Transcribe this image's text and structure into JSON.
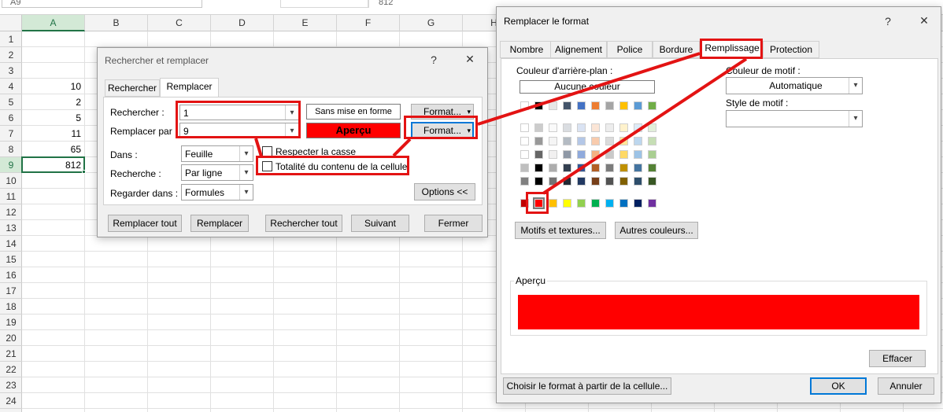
{
  "sheet": {
    "name_box": "A9",
    "formula_value": "812",
    "columns": [
      "A",
      "B",
      "C",
      "D",
      "E",
      "F",
      "G",
      "H"
    ],
    "rows": [
      "1",
      "2",
      "3",
      "4",
      "5",
      "6",
      "7",
      "8",
      "9",
      "10",
      "11",
      "12",
      "13",
      "14",
      "15",
      "16",
      "17",
      "18",
      "19",
      "20",
      "21",
      "22",
      "23",
      "24"
    ],
    "cells": [
      {
        "row": 4,
        "value": "10"
      },
      {
        "row": 5,
        "value": "2"
      },
      {
        "row": 6,
        "value": "5"
      },
      {
        "row": 7,
        "value": "11"
      },
      {
        "row": 8,
        "value": "65"
      },
      {
        "row": 9,
        "value": "812"
      }
    ]
  },
  "find_replace": {
    "title": "Rechercher et remplacer",
    "help": "?",
    "close": "✕",
    "tab_find": "Rechercher",
    "tab_replace": "Remplacer",
    "find_label": "Rechercher :",
    "find_value": "1",
    "replace_label": "Remplacer par :",
    "replace_value": "9",
    "find_format_preview": "Sans mise en forme",
    "replace_format_preview": "Aperçu",
    "format_button": "Format...",
    "dans_label": "Dans :",
    "dans_value": "Feuille",
    "recherche_label": "Recherche :",
    "recherche_value": "Par ligne",
    "regarder_label": "Regarder dans :",
    "regarder_value": "Formules",
    "match_case": "Respecter la casse",
    "match_entire": "Totalité du contenu de la cellule",
    "options_button": "Options <<",
    "replace_all": "Remplacer tout",
    "replace": "Remplacer",
    "find_all": "Rechercher tout",
    "find_next": "Suivant",
    "close_button": "Fermer"
  },
  "format_dialog": {
    "title": "Remplacer le format",
    "help": "?",
    "close": "✕",
    "tabs": [
      "Nombre",
      "Alignement",
      "Police",
      "Bordure",
      "Remplissage",
      "Protection"
    ],
    "active_tab": "Remplissage",
    "bg_color_label": "Couleur d'arrière-plan :",
    "no_color": "Aucune couleur",
    "pattern_color_label": "Couleur de motif :",
    "pattern_color_value": "Automatique",
    "pattern_style_label": "Style de motif :",
    "pattern_style_value": "",
    "patterns_button": "Motifs et textures...",
    "more_colors_button": "Autres couleurs...",
    "preview_label": "Aperçu",
    "clear_button": "Effacer",
    "pick_from_cell_button": "Choisir le format à partir de la cellule...",
    "ok_button": "OK",
    "cancel_button": "Annuler",
    "preview_color": "#ff0000",
    "selected_color": "#ff0000",
    "theme_colors": [
      "#ffffff",
      "#000000",
      "#e7e6e6",
      "#44546a",
      "#4472c4",
      "#ed7d31",
      "#a5a5a5",
      "#ffc000",
      "#5b9bd5",
      "#70ad47"
    ],
    "standard_colors": [
      "#c00000",
      "#ff0000",
      "#ffc000",
      "#ffff00",
      "#92d050",
      "#00b050",
      "#00b0f0",
      "#0070c0",
      "#002060",
      "#7030a0"
    ]
  }
}
